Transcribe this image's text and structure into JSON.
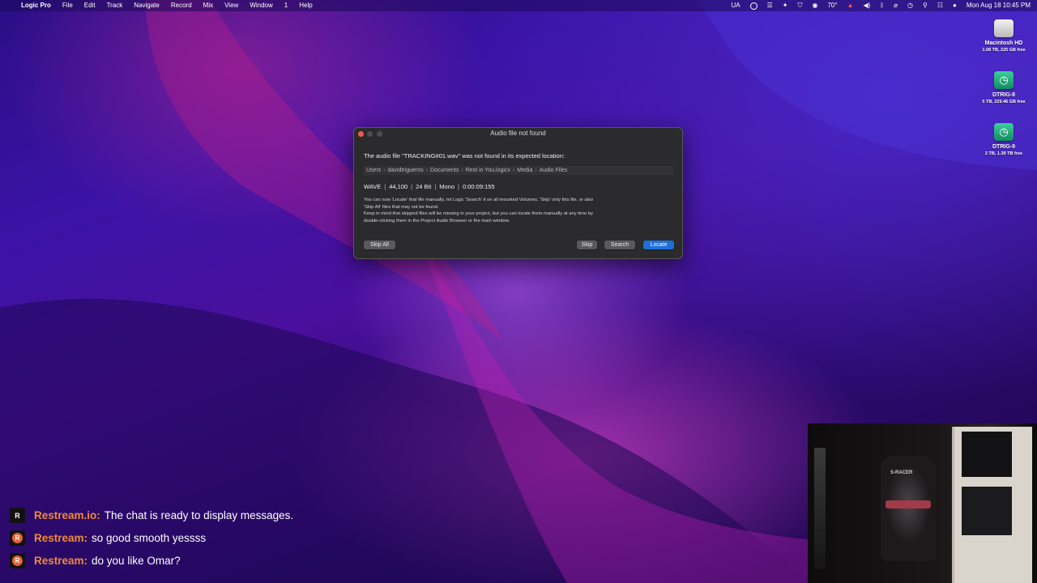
{
  "menubar": {
    "apple_icon": "apple-logo-icon",
    "app_name": "Logic Pro",
    "menus": [
      "File",
      "Edit",
      "Track",
      "Navigate",
      "Record",
      "Mix",
      "View",
      "Window",
      "1",
      "Help"
    ],
    "status": {
      "input_source": "UA",
      "temperature": "70°",
      "datetime": "Mon Aug 18  10:45 PM"
    }
  },
  "desktop": {
    "drives": [
      {
        "name": "Macintosh HD",
        "size": "1.08 TB, 225 GB free",
        "icon": "hard-drive-icon"
      },
      {
        "name": "DTRIG-8",
        "size": "5 TB, 229.46 GB free",
        "icon": "time-machine-drive-icon"
      },
      {
        "name": "DTRIG-9",
        "size": "2 TB, 1.39 TB free",
        "icon": "time-machine-drive-icon"
      }
    ]
  },
  "dialog": {
    "title": "Audio file not found",
    "message": "The audio file \"TRACKING#01.wav\" was not found in its expected location:",
    "path": [
      "Users",
      "davidtrigueros",
      "Documents",
      "Rest in You.logicx",
      "Media",
      "Audio Files"
    ],
    "path_separator": "›",
    "file_info": [
      "WAVE",
      "44,100",
      "24 Bit",
      "Mono",
      "0:00:09:155"
    ],
    "info_separator": "|",
    "description_lines": [
      "You can now 'Locate' that file manually, let Logic 'Search' it on all mounted Volumes, 'Skip' only this file, or also",
      "'Skip All' files that may not be found.",
      "Keep in mind that skipped files will be missing in your project, but you can locate them manually at any time by",
      "double-clicking them in the Project Audio Browser or the main window."
    ],
    "buttons": {
      "skip_all": "Skip All",
      "skip": "Skip",
      "search": "Search",
      "locate": "Locate"
    }
  },
  "chat": {
    "messages": [
      {
        "name": "Restream.io:",
        "text": "The chat is ready to display messages.",
        "avatar": "R"
      },
      {
        "name": "Restream:",
        "text": "so good smooth yessss",
        "avatar": "R"
      },
      {
        "name": "Restream:",
        "text": "do you like Omar?",
        "avatar": "R"
      }
    ]
  },
  "webcam": {
    "chair_label": "S-RACER"
  },
  "colors": {
    "accent_blue": "#1f6fd8",
    "chat_name": "#f08a3a",
    "close_button": "#ee5b52"
  }
}
